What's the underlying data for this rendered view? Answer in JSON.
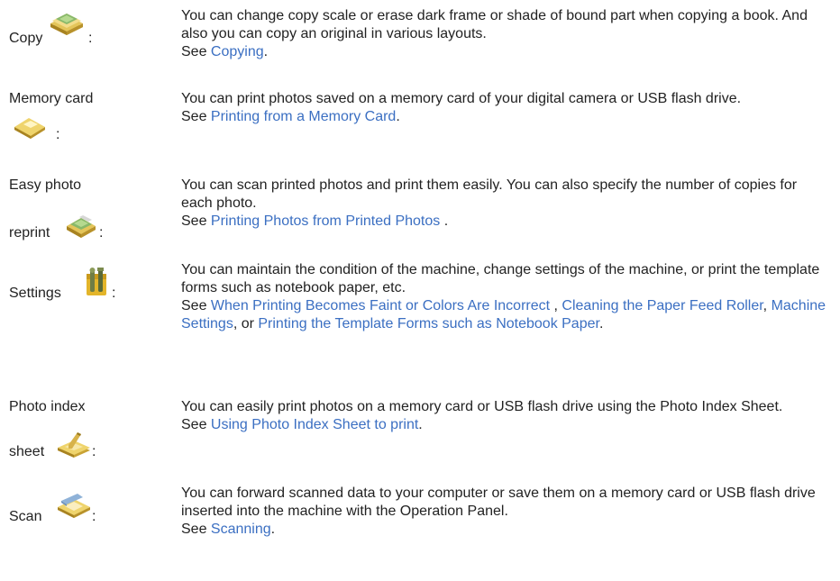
{
  "entries": [
    {
      "term": [
        "Copy"
      ],
      "colon": ":",
      "icon": "copy-icon",
      "text": "You can change copy scale or erase dark frame or shade of bound part when copying a book. And also you can copy an original in various layouts.",
      "see": "See",
      "links": [
        {
          "label": "Copying"
        }
      ],
      "seps": [],
      "end": "."
    },
    {
      "term": [
        "Memory card"
      ],
      "colon": ":",
      "icon": "memory-card-icon",
      "text": "You can print photos saved on a memory card of your digital camera or USB flash drive.",
      "see": "See",
      "links": [
        {
          "label": "Printing from a Memory Card"
        }
      ],
      "seps": [],
      "end": "."
    },
    {
      "term": [
        "Easy photo",
        "reprint"
      ],
      "colon": ":",
      "icon": "easy-photo-reprint-icon",
      "text": "You can scan printed photos and print them easily. You can also specify the number of copies for each photo.",
      "see": "See",
      "links": [
        {
          "label": "Printing Photos from Printed Photos"
        }
      ],
      "seps": [],
      "end": " ."
    },
    {
      "term": [
        "Settings"
      ],
      "colon": ":",
      "icon": "settings-icon",
      "text": "You can maintain the condition of the machine, change settings of the machine, or print the template forms such as notebook paper, etc.",
      "see": "See",
      "links": [
        {
          "label": "When Printing Becomes Faint or Colors Are Incorrect"
        },
        {
          "label": "Cleaning the Paper Feed Roller"
        },
        {
          "label": "Machine Settings"
        },
        {
          "label": "Printing the Template Forms such as Notebook Paper"
        }
      ],
      "seps": [
        " , ",
        ", ",
        ", or "
      ],
      "end": "."
    },
    {
      "term": [
        "Photo index",
        "sheet"
      ],
      "colon": ":",
      "icon": "photo-index-sheet-icon",
      "text": "You can easily print photos on a memory card or USB flash drive using the Photo Index Sheet.",
      "see": "See",
      "links": [
        {
          "label": "Using Photo Index Sheet to print"
        }
      ],
      "seps": [],
      "end": "."
    },
    {
      "term": [
        "Scan"
      ],
      "colon": ":",
      "icon": "scan-icon",
      "text": "You can forward scanned data to your computer or save them on a memory card or USB flash drive inserted into the machine with the Operation Panel.",
      "see": "See",
      "links": [
        {
          "label": "Scanning"
        }
      ],
      "seps": [],
      "end": "."
    }
  ]
}
